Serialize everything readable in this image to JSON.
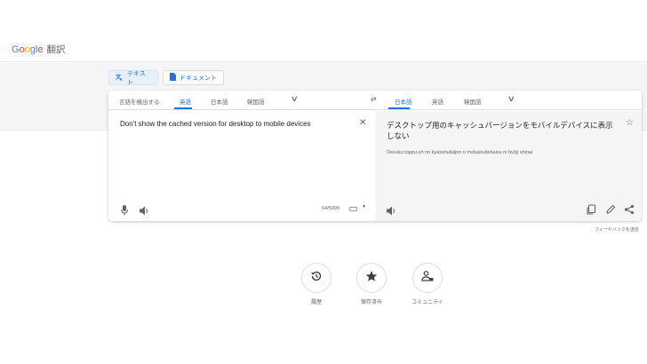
{
  "header": {
    "brand_letters": [
      "G",
      "o",
      "o",
      "g",
      "l",
      "e"
    ],
    "product": "翻訳"
  },
  "modes": {
    "text_label": "テキスト",
    "doc_label": "ドキュメント"
  },
  "source_langs": {
    "detect": "言語を検出する",
    "active": "英語",
    "lang2": "日本語",
    "lang3": "韓国語"
  },
  "target_langs": {
    "active": "日本語",
    "lang2": "英語",
    "lang3": "韓国語"
  },
  "source": {
    "text": "Don't show the cached version for desktop to mobile devices",
    "char_count": "64/5000"
  },
  "target": {
    "text": "デスクトップ用のキャッシュバージョンをモバイルデバイスに表示しない",
    "romanization": "Desuku toppu-yō no kyasshubājon o mobairudebaisu ni hyōji shinai"
  },
  "feedback": "フィードバックを送信",
  "bottom": {
    "history": "履歴",
    "saved": "保存済み",
    "community": "コミュニティ"
  },
  "colors": {
    "accent": "#1a73e8",
    "panel": "#f5f5f5",
    "icon": "#5f6368"
  },
  "icons": [
    "translate-icon",
    "document-icon",
    "chevron-down-icon",
    "swap-icon",
    "close-icon",
    "microphone-icon",
    "speaker-icon",
    "keyboard-icon",
    "star-icon",
    "copy-icon",
    "edit-icon",
    "share-icon",
    "history-icon",
    "saved-star-icon",
    "community-icon"
  ]
}
